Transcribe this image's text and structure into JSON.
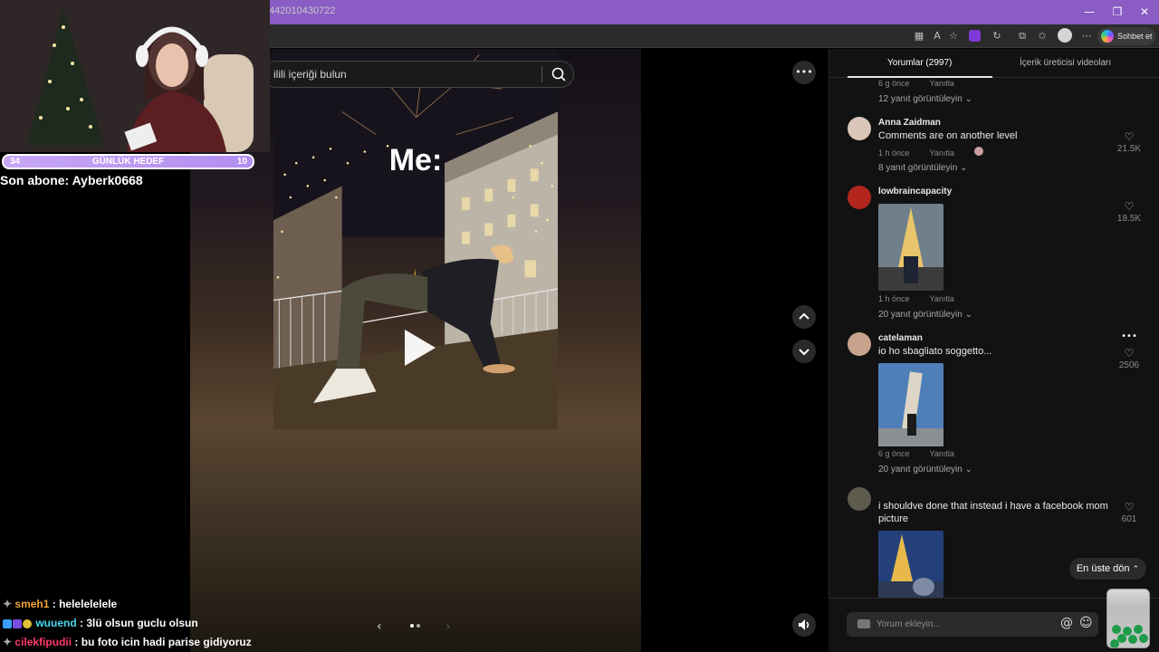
{
  "browser": {
    "url": "442010430722",
    "window_controls": [
      "—",
      "❐",
      "✕"
    ],
    "copilot_label": "Sohbet et"
  },
  "tiktok": {
    "search_placeholder": "ilili içeriği bulun",
    "video_caption": "Me:",
    "more_icon": "•••",
    "nav_up": "⌃",
    "nav_down": "⌄"
  },
  "stream": {
    "goal": {
      "label": "GÜNLÜK HEDEF",
      "current": "34",
      "target": "10"
    },
    "last_sub": "Son abone: Ayberk0668",
    "chat": [
      {
        "user": "smeh1",
        "message": ": helelelelele"
      },
      {
        "user": "wuuend",
        "message": ": 3lü olsun guclu olsun"
      },
      {
        "user": "cilekfipudii",
        "message": ": bu foto icin hadi parise gidiyoruz"
      }
    ]
  },
  "comments_panel": {
    "tabs": {
      "comments": "Yorumlar (2997)",
      "creator_videos": "İçerik üreticisi videoları"
    },
    "top": {
      "time": "6 g önce",
      "reply": "Yanıtla",
      "replies": "12 yanıt görüntüleyin"
    },
    "comments": [
      {
        "user": "Anna Zaidman",
        "text": "Comments are on another level",
        "time": "1 h önce",
        "reply": "Yanıtla",
        "replies": "8 yanıt görüntüleyin",
        "likes": "21.5K"
      },
      {
        "user": "lowbraincapacity",
        "text": "",
        "time": "1 h önce",
        "reply": "Yanıtla",
        "replies": "20 yanıt görüntüleyin",
        "likes": "18.5K"
      },
      {
        "user": "catelaman",
        "text": "io ho sbagliato soggetto...",
        "time": "6 g önce",
        "reply": "Yanıtla",
        "replies": "20 yanıt görüntüleyin",
        "likes": "2506"
      },
      {
        "user": "",
        "text": "i shouldve done that instead i have a facebook mom picture",
        "time": "",
        "reply": "",
        "replies": "",
        "likes": "601"
      }
    ],
    "back_to_top": "En üste dön",
    "comment_placeholder": "Yorum ekleyin..."
  }
}
